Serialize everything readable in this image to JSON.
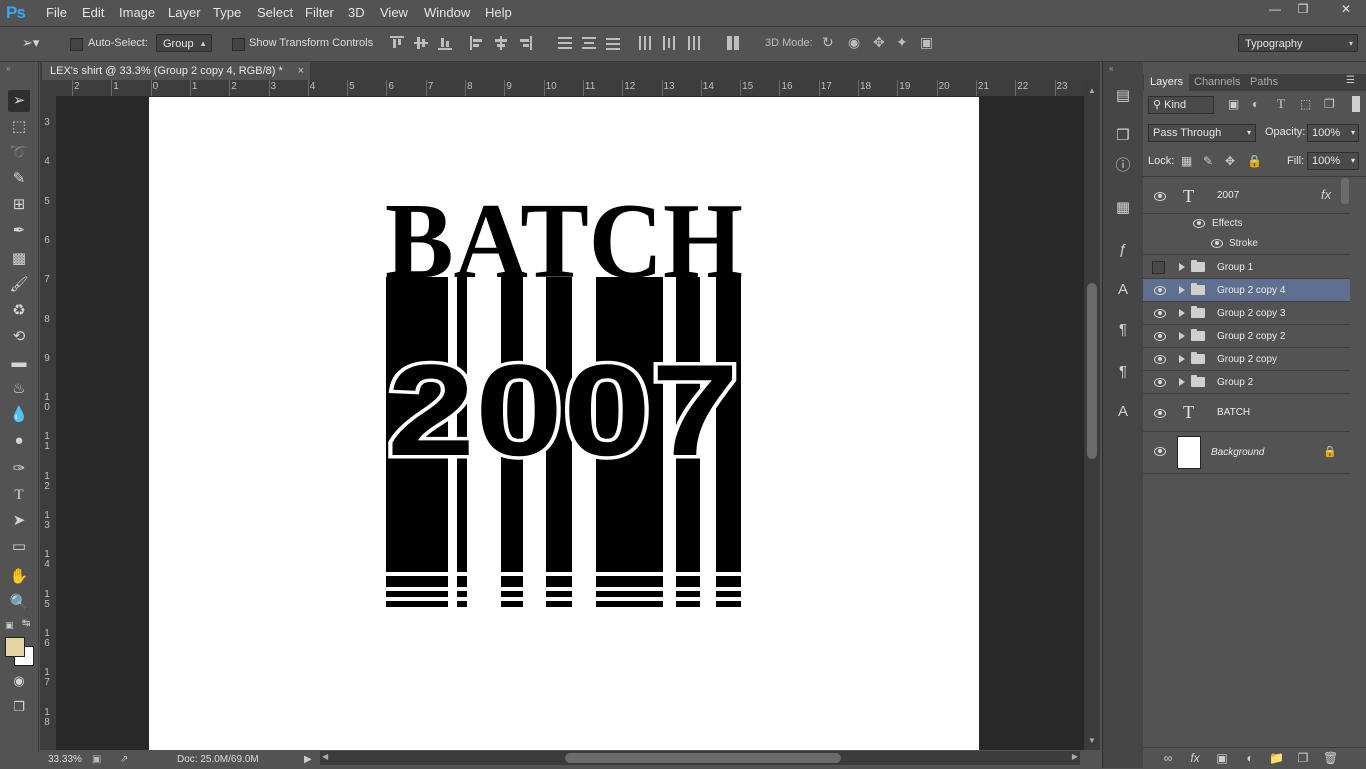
{
  "app": {
    "logo": "Ps"
  },
  "menu": [
    "File",
    "Edit",
    "Image",
    "Layer",
    "Type",
    "Select",
    "Filter",
    "3D",
    "View",
    "Window",
    "Help"
  ],
  "options": {
    "auto_select_label": "Auto-Select:",
    "auto_select_value": "Group",
    "transform_label": "Show Transform Controls",
    "mode_3d_label": "3D Mode:",
    "workspace": "Typography"
  },
  "document": {
    "tab_title": "LEX's shirt @ 33.3% (Group 2 copy 4, RGB/8) *",
    "close": "×",
    "art_top": "BATCH",
    "art_year": "2007"
  },
  "rulers": {
    "top": [
      "2",
      "1",
      "0",
      "1",
      "2",
      "3",
      "4",
      "5",
      "6",
      "7",
      "8",
      "9",
      "10",
      "11",
      "12",
      "13",
      "14",
      "15",
      "16",
      "17",
      "18",
      "19",
      "20",
      "21",
      "22",
      "23"
    ],
    "left": [
      "3",
      "4",
      "5",
      "6",
      "7",
      "8",
      "9",
      "10",
      "11",
      "12",
      "13",
      "14",
      "15",
      "16",
      "17",
      "18"
    ]
  },
  "status": {
    "zoom": "33.33%",
    "doc": "Doc: 25.0M/69.0M"
  },
  "panel": {
    "tabs": [
      "Layers",
      "Channels",
      "Paths"
    ],
    "filter": "Kind",
    "blend_mode": "Pass Through",
    "opacity_label": "Opacity:",
    "opacity_value": "100%",
    "lock_label": "Lock:",
    "fill_label": "Fill:",
    "fill_value": "100%",
    "fx": "fx",
    "effects_label": "Effects",
    "stroke_label": "Stroke",
    "layers": [
      {
        "name": "2007"
      },
      {
        "name": "Group 1"
      },
      {
        "name": "Group 2 copy 4"
      },
      {
        "name": "Group 2 copy 3"
      },
      {
        "name": "Group 2 copy 2"
      },
      {
        "name": "Group 2 copy"
      },
      {
        "name": "Group 2"
      },
      {
        "name": "BATCH"
      },
      {
        "name": "Background"
      }
    ]
  },
  "colors": {
    "accent": "#31a8ff",
    "selection": "#5f6f8f",
    "foreground": "#e8d3a2",
    "background": "#ffffff"
  }
}
